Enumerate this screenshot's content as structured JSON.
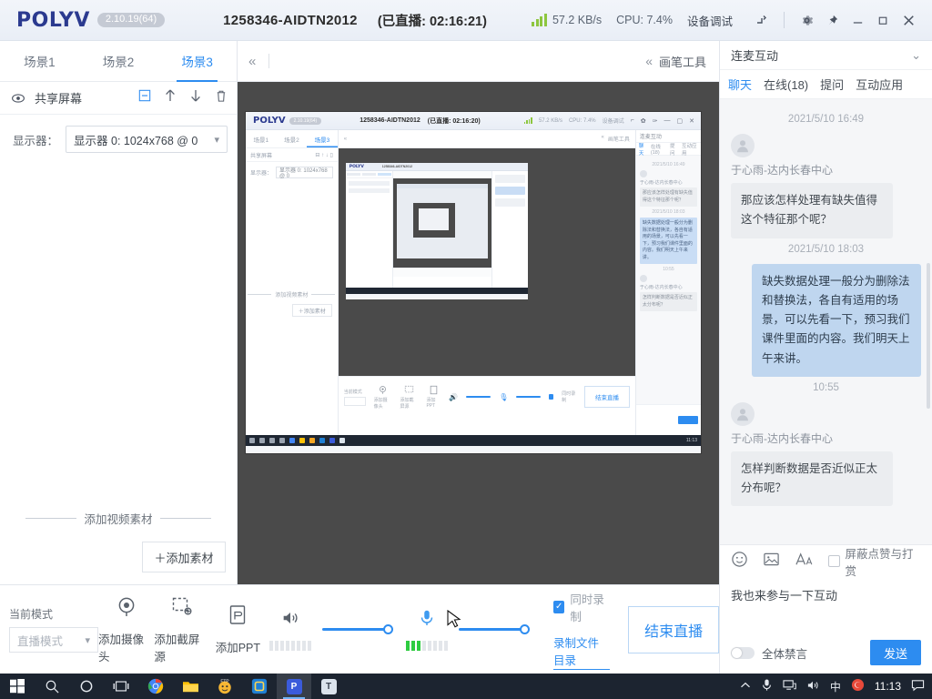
{
  "titlebar": {
    "logo": "POLYV",
    "version": "2.10.19(64)",
    "session_id": "1258346-AIDTN2012",
    "live_time": "(已直播: 02:16:21)",
    "network_speed": "57.2 KB/s",
    "cpu": "CPU: 7.4%",
    "device_debug": "设备调试",
    "icons": {
      "signal": "signal-icon",
      "network": "network-share-icon",
      "settings": "gear-icon",
      "pin": "pin-icon",
      "minimize": "minimize-icon",
      "maximize": "maximize-icon",
      "close": "close-icon"
    }
  },
  "sidebar": {
    "scene_tabs": [
      {
        "label": "场景1",
        "active": false
      },
      {
        "label": "场景2",
        "active": false
      },
      {
        "label": "场景3",
        "active": true
      }
    ],
    "source": {
      "name": "共享屏幕",
      "eye_icon": "eye-icon",
      "actions": [
        "minus-box-icon",
        "arrow-up-icon",
        "arrow-down-icon",
        "trash-icon"
      ]
    },
    "monitor": {
      "label": "显示器：",
      "value": "显示器 0: 1024x768 @ 0"
    },
    "add_video_divider": "添加视频素材",
    "add_material_button": "＋添加素材"
  },
  "preview": {
    "collapse_icon": "chevron-double-left-icon",
    "pen_tools_label": "画笔工具",
    "pen_tools_chevron": "chevron-double-left-icon",
    "canvas_bg": "#4a4a4a"
  },
  "bottom_toolbar": {
    "mode_label": "当前模式",
    "mode_value": "直播模式",
    "tools": [
      {
        "label": "添加摄像头",
        "icon": "camera-icon"
      },
      {
        "label": "添加截屏源",
        "icon": "screen-capture-icon"
      },
      {
        "label": "添加PPT",
        "icon": "ppt-file-icon"
      }
    ],
    "speaker_icon": "speaker-icon",
    "mic_icon": "microphone-icon",
    "speaker_volume": 100,
    "mic_volume": 100,
    "record_checkbox_label": "同时录制",
    "record_checked": true,
    "record_dir_link": "录制文件目录",
    "end_live_button": "结束直播"
  },
  "chat": {
    "header": "连麦互动",
    "header_chevron": "chevron-down-icon",
    "tabs": [
      {
        "label": "聊天",
        "active": true
      },
      {
        "label": "在线(18)",
        "active": false
      },
      {
        "label": "提问",
        "active": false
      },
      {
        "label": "互动应用",
        "active": false
      }
    ],
    "messages": [
      {
        "type": "time",
        "text": "2021/5/10 16:49"
      },
      {
        "type": "other",
        "name": "于心雨-达内长春中心",
        "text": "那应该怎样处理有缺失值得这个特征那个呢？"
      },
      {
        "type": "time",
        "text": "2021/5/10 18:03"
      },
      {
        "type": "me",
        "text": "缺失数据处理一般分为删除法和替换法，各自有适用的场景，可以先看一下，预习我们课件里面的内容。我们明天上午来讲。"
      },
      {
        "type": "time",
        "text": "10:55"
      },
      {
        "type": "other",
        "name": "于心雨-达内长春中心",
        "text": "怎样判断数据是否近似正太分布呢？"
      }
    ],
    "toolbar_icons": [
      "emoji-icon",
      "image-icon",
      "font-size-icon"
    ],
    "shield_label": "屏蔽点赞与打赏",
    "shield_checked": false,
    "input_value": "我也来参与一下互动",
    "mute_all_label": "全体禁言",
    "mute_all_on": false,
    "send_button": "发送"
  },
  "nested_window": {
    "logo": "POLYV",
    "version": "2.10.19(64)",
    "session_id": "1258346-AIDTN2012",
    "live_time": "(已直播: 02:16:20)",
    "network_speed": "57.2 KB/s",
    "cpu": "CPU: 7.4%",
    "device_debug": "设备调试",
    "scene_tabs": [
      "场景1",
      "场景2",
      "场景3"
    ],
    "source_name": "共享屏幕",
    "monitor_label": "显示器：",
    "monitor_value": "显示器 0: 1024x768 @ 0",
    "pen_tools_label": "画笔工具",
    "add_video_divider": "添加视频素材",
    "add_material_button": "＋添加素材",
    "mode_label": "当前模式",
    "mode_value": "直播模式",
    "tools": [
      "添加摄像头",
      "添加截屏源",
      "添加PPT"
    ],
    "record_checkbox_label": "同时录制",
    "record_dir_link": "录制文件目录",
    "end_live_button": "结束直播",
    "chat_header": "连麦互动",
    "chat_tabs": [
      "聊天",
      "在线(18)",
      "提问",
      "互动应用"
    ],
    "chat_time_1": "2021/5/10 16:49",
    "chat_name_1": "于心雨-达内长春中心",
    "chat_msg_1": "那应该怎样处理有缺失值得这个特征那个呢？",
    "chat_time_2": "2021/5/10 18:03",
    "chat_msg_2": "缺失数据处理一般分为删除法和替换法，各自有适用的场景，可以先看一下，预习我们课件里面的内容。我们明天上午来讲。",
    "chat_time_3": "10:55",
    "chat_name_2": "于心雨-达内长春中心",
    "chat_msg_3": "怎样判断数据是否近似正太分布呢？",
    "taskbar_time": "11:13"
  },
  "taskbar": {
    "start_icon": "windows-start-icon",
    "search_icon": "search-icon",
    "cortana_icon": "cortana-circle-icon",
    "taskview_icon": "task-view-icon",
    "apps": [
      {
        "name": "chrome-icon",
        "letter": "",
        "color": "#4285f4"
      },
      {
        "name": "file-explorer-icon",
        "letter": "",
        "color": "#ffc107"
      },
      {
        "name": "ftp-icon",
        "letter": "",
        "color": "#f5a623"
      },
      {
        "name": "vmware-icon",
        "letter": "",
        "color": "#1f7fd4"
      },
      {
        "name": "polyv-icon",
        "letter": "P",
        "color": "#3b5bdb"
      },
      {
        "name": "text-editor-icon",
        "letter": "T",
        "color": "#dbe3ec"
      }
    ],
    "tray": {
      "expand_icon": "chevron-up-icon",
      "mic_icon": "microphone-icon",
      "network_icon": "network-icon",
      "volume_icon": "volume-icon",
      "ime": "中",
      "sogou_icon": "sogou-icon",
      "clock": "11:13",
      "notification_icon": "notification-icon"
    }
  },
  "colors": {
    "accent": "#2d8cf0",
    "brand": "#2b3a8f",
    "canvas": "#4a4a4a",
    "taskbar": "#1c2430",
    "chat_bg": "#f5f6f8",
    "me_bubble": "#bfd6ef",
    "other_bubble": "#ebedf0",
    "meter_green": "#2ecc40",
    "signal_green": "#8dc63f"
  }
}
